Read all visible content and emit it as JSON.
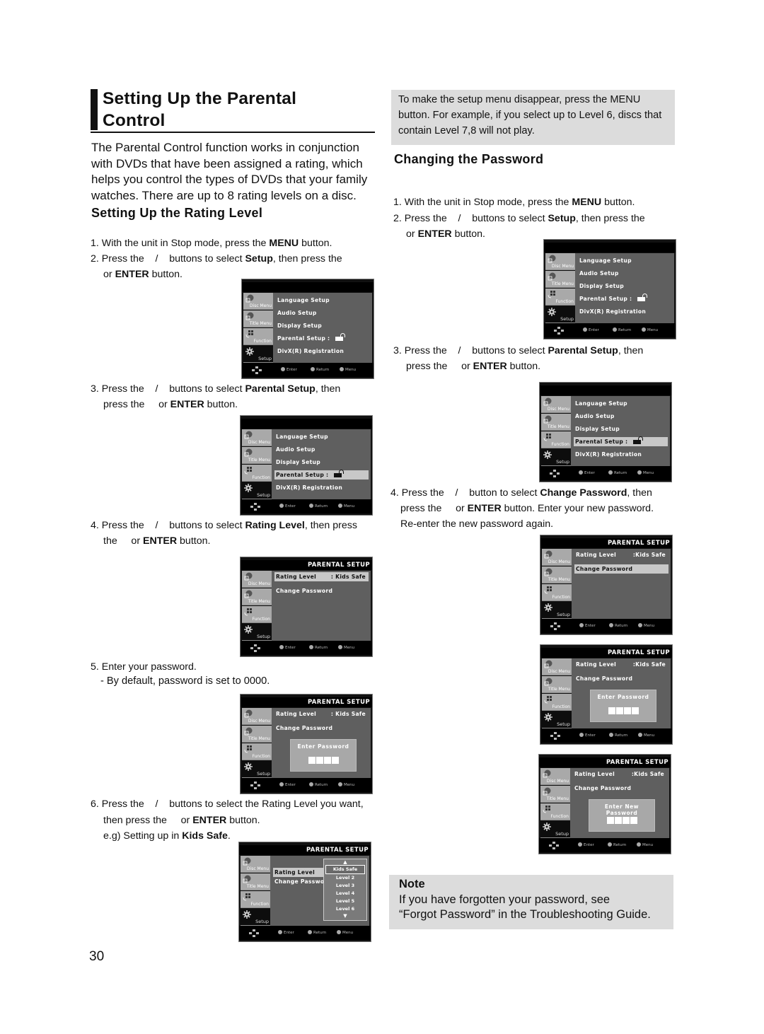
{
  "page": {
    "title": "Setting Up the Parental Control",
    "title_lines": [
      "Setting Up the Parental",
      "Control"
    ],
    "intro": "The Parental Control function works in conjunction with DVDs that have been assigned a rating, which helps you control the types of DVDs that your family watches. There are up to 8 rating levels on a disc.",
    "page_number": "30"
  },
  "rating_section": {
    "heading": "Setting Up the Rating Level",
    "steps": [
      {
        "num": "1.",
        "parts": [
          "With the unit in Stop mode, press the ",
          "MENU",
          " button."
        ]
      },
      {
        "num": "2.",
        "parts": [
          "Press the    /    buttons to select ",
          "Setup",
          ", then press the"
        ],
        "cont": [
          "or ",
          "ENTER",
          " button."
        ]
      },
      {
        "num": "3.",
        "parts": [
          "Press the    /    buttons to select ",
          "Parental Setup",
          ", then"
        ],
        "cont": [
          "press the     or ",
          "ENTER",
          " button."
        ]
      },
      {
        "num": "4.",
        "parts": [
          "Press the    /    buttons to select ",
          "Rating Level",
          ", then press"
        ],
        "cont": [
          "the     or ",
          "ENTER",
          " button."
        ]
      },
      {
        "num": "5.",
        "parts": [
          "Enter your password.",
          "",
          ""
        ],
        "cont": [
          "- By default, password is set to 0000.",
          "",
          ""
        ]
      },
      {
        "num": "6.",
        "parts": [
          "Press the    /    buttons to select the Rating Level you want,",
          "",
          ""
        ],
        "cont": [
          "then press the     or ",
          "ENTER",
          " button."
        ],
        "cont2": [
          "e.g) Setting up in ",
          "Kids Safe",
          "."
        ]
      }
    ]
  },
  "tip_box": {
    "text": "To make the setup menu disappear, press the MENU button. For example, if you select up to Level 6, discs that contain Level 7,8 will not play."
  },
  "password_section": {
    "heading": "Changing the Password",
    "steps": [
      {
        "num": "1.",
        "parts": [
          "With the unit in Stop mode, press the ",
          "MENU",
          " button."
        ]
      },
      {
        "num": "2.",
        "parts": [
          "Press the    /    buttons to select ",
          "Setup",
          ", then press the"
        ],
        "cont": [
          "or ",
          "ENTER",
          " button."
        ]
      },
      {
        "num": "3.",
        "parts": [
          "Press the    /    buttons to select ",
          "Parental Setup",
          ", then"
        ],
        "cont": [
          "press the     or ",
          "ENTER",
          " button."
        ]
      },
      {
        "num": "4.",
        "parts": [
          "Press the    /    button to select ",
          "Change Password",
          ", then"
        ],
        "cont": [
          "press the     or ",
          "ENTER",
          " button. Enter your new password."
        ],
        "cont2": [
          "Re-enter the new password again.",
          "",
          ""
        ]
      }
    ]
  },
  "note": {
    "title": "Note",
    "lines": [
      "If you have forgotten your password, see",
      "“Forgot Password” in the Troubleshooting Guide."
    ]
  },
  "osd": {
    "sidebar": [
      "Disc Menu",
      "Title Menu",
      "Function",
      "Setup"
    ],
    "setup_items": [
      "Language Setup",
      "Audio Setup",
      "Display Setup",
      "Parental Setup :",
      "DivX(R) Registration"
    ],
    "parental_header": "PARENTAL SETUP",
    "rating_label": "Rating Level",
    "rating_value": ": Kids Safe",
    "rating_value_alt": ":Kids Safe",
    "change_password": "Change Password",
    "change_password_trunc": "Change Passwor",
    "enter_password": "Enter Password",
    "enter_new_password": "Enter New Password",
    "levels": [
      "Kids Safe",
      "Level 2",
      "Level 3",
      "Level 4",
      "Level 5",
      "Level 6"
    ],
    "footer": {
      "enter": "Enter",
      "return": "Return",
      "menu": "Menu"
    }
  }
}
